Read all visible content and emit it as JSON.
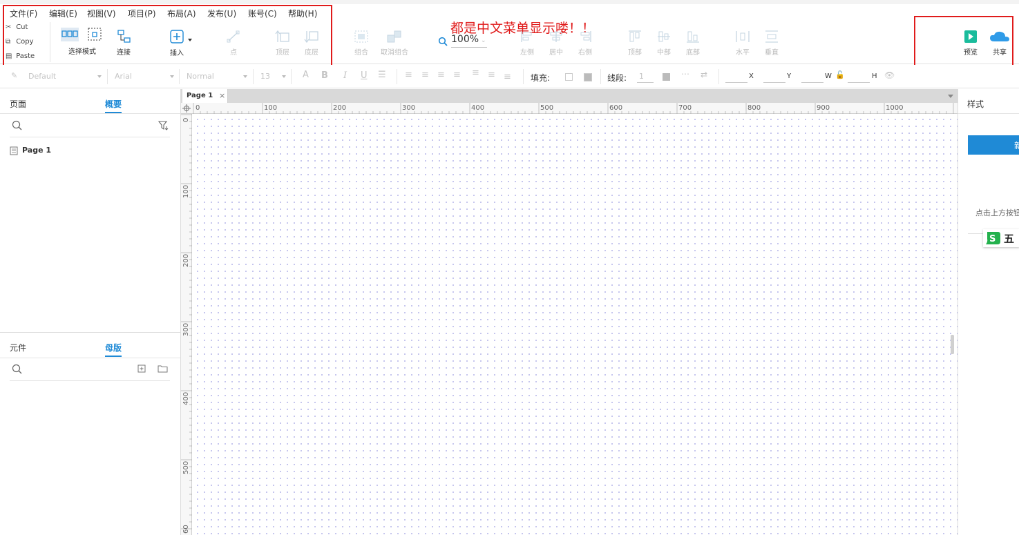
{
  "menu": [
    "文件(F)",
    "编辑(E)",
    "视图(V)",
    "项目(P)",
    "布局(A)",
    "发布(U)",
    "账号(C)",
    "帮助(H)"
  ],
  "annotation": "都是中文菜单显示喽！！",
  "clipboard": {
    "cut": "Cut",
    "copy": "Copy",
    "paste": "Paste"
  },
  "toolbar": {
    "select_mode": "选择模式",
    "connect": "连接",
    "insert": "插入",
    "point": "点",
    "top_layer": "顶层",
    "bottom_layer": "底层",
    "group": "组合",
    "ungroup": "取消组合",
    "zoom": "100%",
    "align_left": "左侧",
    "align_center": "居中",
    "align_right": "右侧",
    "align_top": "顶部",
    "align_middle": "中部",
    "align_bottom": "底部",
    "distribute_h": "水平",
    "distribute_v": "垂直",
    "preview": "预览",
    "share": "共享"
  },
  "format": {
    "style": "Default",
    "font": "Arial",
    "weight": "Normal",
    "size": "13",
    "fill_label": "填充:",
    "stroke_label": "线段:",
    "stroke_value": "1",
    "x": "X",
    "y": "Y",
    "w": "W",
    "h": "H"
  },
  "left_panel": {
    "tabs_top": [
      "页面",
      "概要"
    ],
    "page_item": "Page 1",
    "tabs_bottom": [
      "元件",
      "母版"
    ]
  },
  "canvas": {
    "tab": "Page 1",
    "ruler_h": [
      "0",
      "100",
      "200",
      "300",
      "400",
      "500",
      "600",
      "700",
      "800",
      "900",
      "1000"
    ],
    "ruler_v": [
      "0",
      "100",
      "200",
      "300",
      "400",
      "500",
      "60"
    ]
  },
  "right_panel": {
    "tab": "样式",
    "button_partial": "新",
    "hint": "点击上方按钮",
    "ime_char": "五"
  },
  "colors": {
    "accent": "#1f8ad6",
    "annotation": "#e01b1b",
    "preview": "#1abc9c",
    "share": "#2f9be8"
  }
}
